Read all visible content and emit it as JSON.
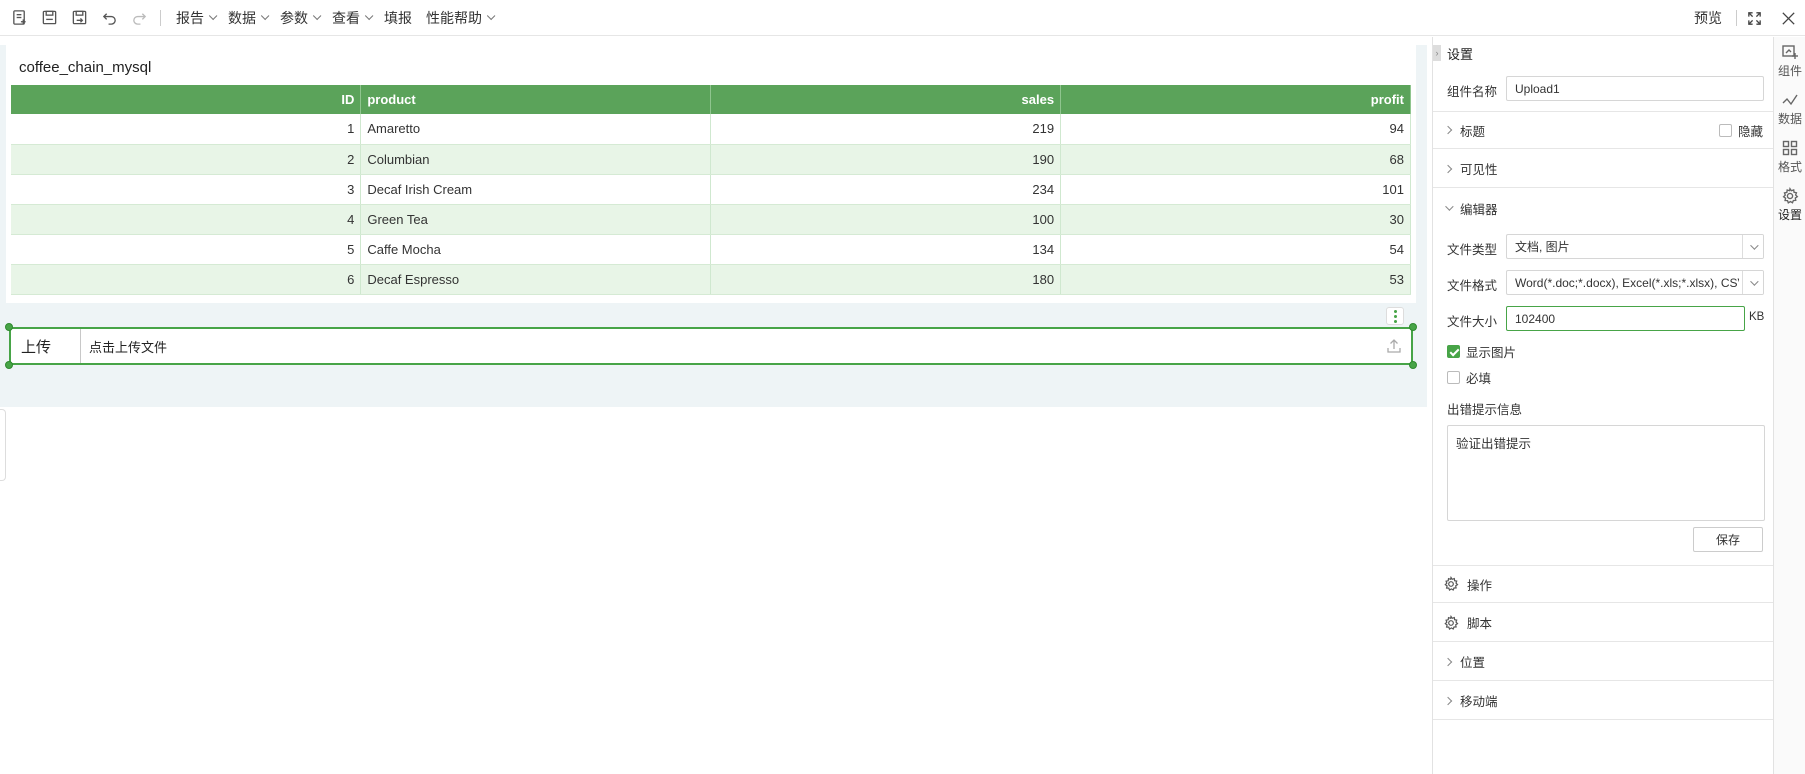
{
  "toolbar": {
    "menus": [
      "报告",
      "数据",
      "参数",
      "查看",
      "填报",
      "性能帮助"
    ],
    "preview_label": "预览"
  },
  "report": {
    "title": "coffee_chain_mysql",
    "columns": [
      "ID",
      "product",
      "sales",
      "profit"
    ],
    "rows": [
      [
        "1",
        "Amaretto",
        "219",
        "94"
      ],
      [
        "2",
        "Columbian",
        "190",
        "68"
      ],
      [
        "3",
        "Decaf Irish Cream",
        "234",
        "101"
      ],
      [
        "4",
        "Green Tea",
        "100",
        "30"
      ],
      [
        "5",
        "Caffe Mocha",
        "134",
        "54"
      ],
      [
        "6",
        "Decaf Espresso",
        "180",
        "53"
      ]
    ]
  },
  "upload": {
    "label": "上传",
    "placeholder": "点击上传文件"
  },
  "panel": {
    "title": "设置",
    "component_name_label": "组件名称",
    "component_name_value": "Upload1",
    "sections": {
      "title": "标题",
      "hide": "隐藏",
      "visibility": "可见性",
      "editor": "编辑器",
      "operation": "操作",
      "script": "脚本",
      "position": "位置",
      "mobile": "移动端"
    },
    "file_type_label": "文件类型",
    "file_type_value": "文档, 图片",
    "file_format_label": "文件格式",
    "file_format_value": "Word(*.doc;*.docx), Excel(*.xls;*.xlsx), CSV(*...",
    "file_size_label": "文件大小",
    "file_size_value": "102400",
    "file_size_unit": "KB",
    "show_image_label": "显示图片",
    "show_image_checked": true,
    "required_label": "必填",
    "required_checked": false,
    "error_label": "出错提示信息",
    "error_value": "验证出错提示",
    "save_label": "保存"
  },
  "vtabs": [
    "组件",
    "数据",
    "格式",
    "设置"
  ],
  "colors": {
    "header_green": "#5ba35a",
    "row_alt": "#e8f5e7",
    "accent": "#47a447"
  }
}
